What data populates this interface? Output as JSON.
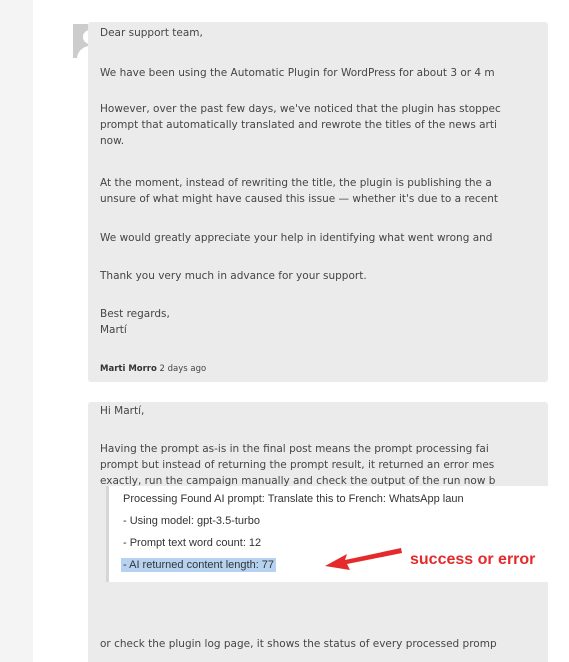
{
  "first_message": {
    "greeting": "Dear support team,",
    "paragraph1": "We have been using the Automatic Plugin for WordPress for about 3 or 4 m",
    "paragraph2_line1": "However, over the past few days, we've noticed that the plugin has stoppec",
    "paragraph2_line2": "prompt that automatically translated and rewrote the titles of the news arti",
    "paragraph2_line3": "now.",
    "paragraph3_line1": "At the moment, instead of rewriting the title, the plugin is publishing the a",
    "paragraph3_line2": "unsure of what might have caused this issue — whether it's due to a recent",
    "paragraph4": "We would greatly appreciate your help in identifying what went wrong and",
    "paragraph5": "Thank you very much in advance for your support.",
    "signoff_line1": "Best regards,",
    "signoff_line2": "Martí",
    "author": "Marti Morro",
    "time": "2 days ago"
  },
  "second_message": {
    "greeting": "Hi Martí,",
    "paragraph1_line1": "Having the prompt as-is in the final post means the prompt processing fai",
    "paragraph1_line2": "prompt but instead of returning the prompt result, it returned an error mes",
    "paragraph1_line3": "exactly, run the campaign manually and check the output of the run now b",
    "log_lines": [
      "Processing Found AI prompt: Translate this to French: WhatsApp laun",
      "- Using model: gpt-3.5-turbo",
      "- Prompt text word count: 12"
    ],
    "highlighted_line": "- AI returned content length: 77",
    "annotation": "success or error",
    "paragraph2": "or check the plugin log page, it shows the status of every processed promp"
  },
  "colors": {
    "annotation_red": "#e42a2a",
    "highlight_blue": "#b5d3f1"
  }
}
